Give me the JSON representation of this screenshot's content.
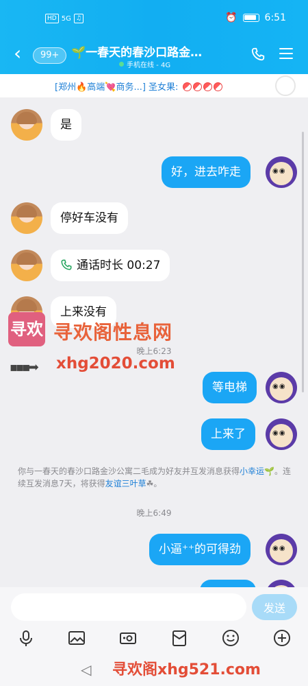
{
  "status": {
    "chips": [
      "HD",
      "5G"
    ],
    "time": "6:51"
  },
  "header": {
    "back_count": "99+",
    "title": "🌱一春天的春沙口路金…",
    "online_status": "手机在线 - 4G"
  },
  "tagbar": {
    "text": "[郑州🔥高端💘商务...] 圣女果:"
  },
  "messages": [
    {
      "from": "other",
      "text": "是"
    },
    {
      "from": "me",
      "text": "好，进去咋走"
    },
    {
      "from": "other",
      "text": "停好车没有"
    },
    {
      "from": "other",
      "text": "通话时长 00:27",
      "type": "call"
    },
    {
      "from": "other",
      "text": "上来没有"
    },
    {
      "from": "me",
      "text": "等电梯"
    },
    {
      "from": "me",
      "text": "上来了"
    },
    {
      "from": "me",
      "text": "小逼⁺⁺的可得劲"
    }
  ],
  "timestamps": {
    "t1": "晚上6:23",
    "t2": "晚上6:49"
  },
  "notice": {
    "part1": "你与一春天的春沙口路金沙公寓二毛成为好友并互发消息获得",
    "link1": "小幸运",
    "part2": "🌱。连续互发消息7天，将获得",
    "link2": "友谊三叶草",
    "part3": "☘。"
  },
  "watermark": {
    "logo": "寻欢",
    "name": "寻欢阁性息网",
    "url": "xhg2020.com",
    "bottom": "寻欢阁xhg521.com"
  },
  "input": {
    "value": "",
    "send_label": "发送"
  },
  "colors": {
    "header": "#12aef2",
    "bubble_out": "#1ba6f5",
    "send_disabled": "#a8dbf8"
  }
}
